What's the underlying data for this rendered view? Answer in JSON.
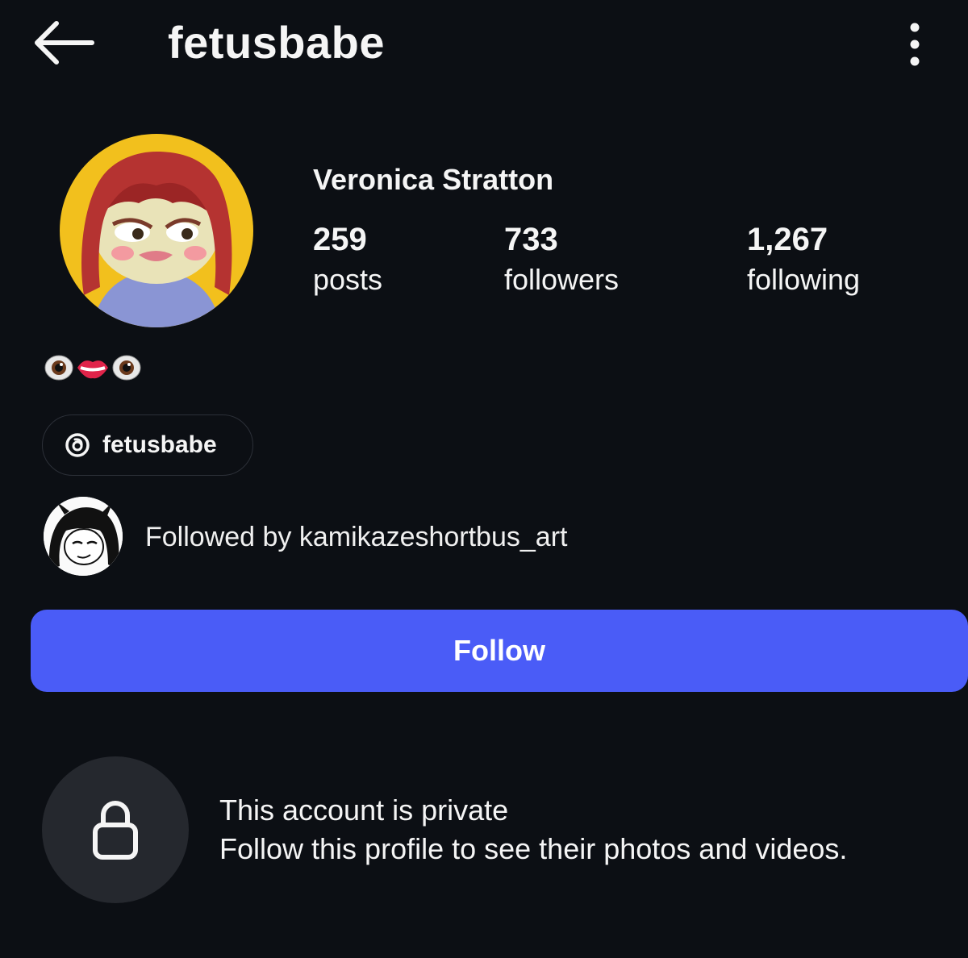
{
  "header": {
    "title": "fetusbabe",
    "back_icon": "arrow-left-icon",
    "more_icon": "more-vertical-icon"
  },
  "profile": {
    "display_name": "Veronica Stratton",
    "stats": [
      {
        "value": "259",
        "label": "posts"
      },
      {
        "value": "733",
        "label": "followers"
      },
      {
        "value": "1,267",
        "label": "following"
      }
    ],
    "bio": [
      "eyes-emoji-icon",
      "lips-emoji-icon",
      "eyes-emoji-icon"
    ]
  },
  "threads": {
    "label": "fetusbabe",
    "icon": "threads-icon"
  },
  "followed_by": {
    "text": "Followed by kamikazeshortbus_art"
  },
  "follow_button": {
    "label": "Follow",
    "color": "#4a5cf7"
  },
  "private_notice": {
    "title": "This account is private",
    "subtitle": "Follow this profile to see their photos and videos.",
    "icon": "lock-icon"
  },
  "colors": {
    "background": "#0c0f14",
    "text": "#f5f5f5"
  }
}
